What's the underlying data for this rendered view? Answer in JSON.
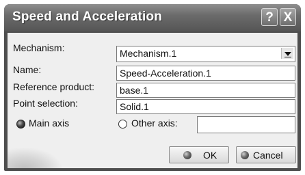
{
  "window": {
    "title": "Speed and Acceleration",
    "help_label": "?",
    "close_label": "X"
  },
  "form": {
    "mechanism_label": "Mechanism:",
    "mechanism_value": "Mechanism.1",
    "name_label": "Name:",
    "name_value": "Speed-Acceleration.1",
    "reference_product_label": "Reference product:",
    "reference_product_value": "base.1",
    "point_selection_label": "Point selection:",
    "point_selection_value": "Solid.1",
    "main_axis_label": "Main axis",
    "main_axis_selected": true,
    "other_axis_label": "Other axis:",
    "other_axis_value": ""
  },
  "buttons": {
    "ok_label": "OK",
    "cancel_label": "Cancel"
  }
}
